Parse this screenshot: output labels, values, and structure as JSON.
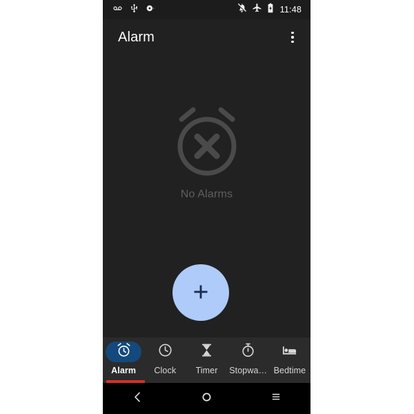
{
  "theme": {
    "page_background": "#ffffff",
    "screen_background": "#212121",
    "status_bar_background": "#1c1c1c",
    "bottom_nav_background": "#2b2b2b",
    "system_nav_background": "#000000",
    "fab_color": "#aecbfa",
    "fab_icon_color": "#1a2b4d",
    "selected_pill_color": "#14497d",
    "selected_indicator_color": "#d93025",
    "primary_text_color": "#ffffff",
    "muted_text_color": "#5f5f5f",
    "illustration_color": "#4a4a4a"
  },
  "status_bar": {
    "time": "11:48",
    "left_icons": [
      {
        "name": "voicemail-icon",
        "label": "Voicemail"
      },
      {
        "name": "usb-icon",
        "label": "USB connected"
      },
      {
        "name": "screen-record-icon",
        "label": "Screen recording"
      }
    ],
    "right_icons": [
      {
        "name": "notifications-off-icon",
        "label": "Silent / notifications off"
      },
      {
        "name": "airplane-mode-icon",
        "label": "Airplane mode"
      },
      {
        "name": "battery-icon",
        "label": "Battery"
      }
    ]
  },
  "app_bar": {
    "title": "Alarm",
    "overflow_menu_label": "More options"
  },
  "empty_state": {
    "illustration": "alarm-off-icon",
    "message": "No Alarms"
  },
  "fab": {
    "icon": "plus-icon",
    "label": "Add alarm"
  },
  "bottom_nav": {
    "selected_index": 0,
    "tabs": [
      {
        "label": "Alarm",
        "icon": "alarm-clock-icon",
        "selected": true
      },
      {
        "label": "Clock",
        "icon": "clock-icon",
        "selected": false
      },
      {
        "label": "Timer",
        "icon": "hourglass-icon",
        "selected": false
      },
      {
        "label": "Stopwa…",
        "icon": "stopwatch-icon",
        "selected": false
      },
      {
        "label": "Bedtime",
        "icon": "bed-icon",
        "selected": false
      }
    ]
  },
  "system_nav": {
    "buttons": [
      {
        "name": "back-button",
        "icon": "chevron-left-icon",
        "label": "Back"
      },
      {
        "name": "home-button",
        "icon": "circle-icon",
        "label": "Home"
      },
      {
        "name": "recents-button",
        "icon": "menu-lines-icon",
        "label": "Recent apps"
      }
    ]
  }
}
